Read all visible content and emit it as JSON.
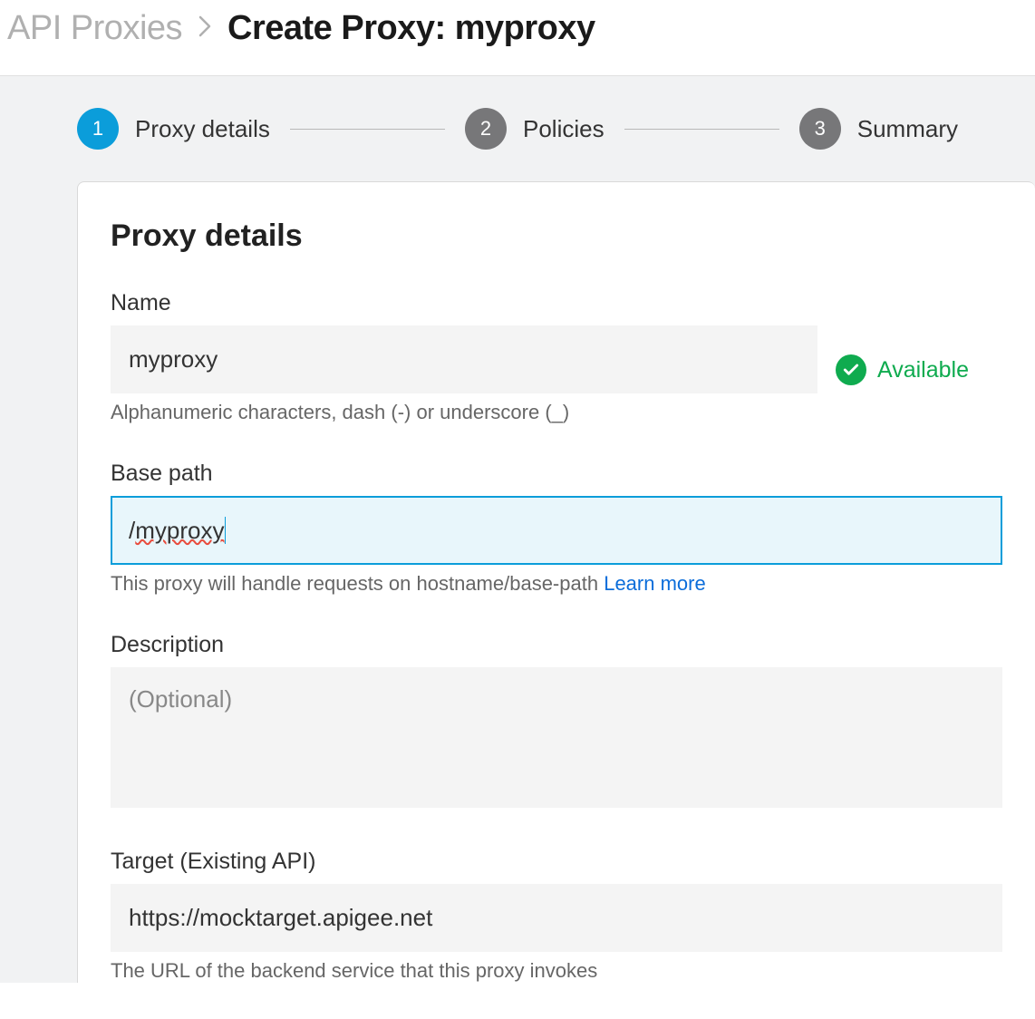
{
  "breadcrumb": {
    "parent": "API Proxies",
    "current": "Create Proxy: myproxy"
  },
  "stepper": {
    "steps": [
      {
        "num": "1",
        "label": "Proxy details",
        "active": true
      },
      {
        "num": "2",
        "label": "Policies",
        "active": false
      },
      {
        "num": "3",
        "label": "Summary",
        "active": false
      }
    ]
  },
  "section": {
    "title": "Proxy details"
  },
  "fields": {
    "name": {
      "label": "Name",
      "value": "myproxy",
      "helper": "Alphanumeric characters, dash (-) or underscore (_)",
      "status": "Available"
    },
    "basepath": {
      "label": "Base path",
      "value_prefix": "/",
      "value_word": "myproxy",
      "helper": "This proxy will handle requests on hostname/base-path ",
      "learn_more": "Learn more"
    },
    "description": {
      "label": "Description",
      "placeholder": "(Optional)",
      "value": ""
    },
    "target": {
      "label": "Target (Existing API)",
      "value": "https://mocktarget.apigee.net",
      "helper": "The URL of the backend service that this proxy invokes"
    }
  }
}
